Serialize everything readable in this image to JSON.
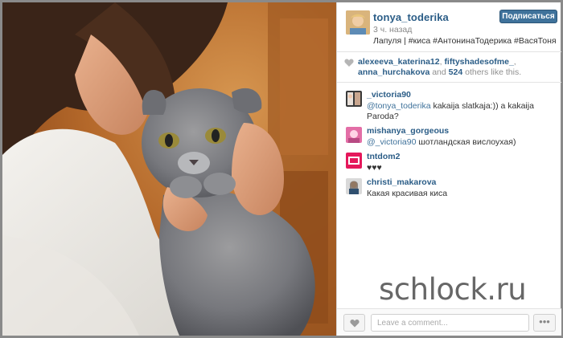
{
  "post": {
    "username": "tonya_toderika",
    "time": "3 ч. назад",
    "caption": "Лапуля | #киса #АнтонинаТодерика #ВасяТоня",
    "follow_label": "Подписаться"
  },
  "likes": {
    "user1": "alexeeva_katerina12",
    "sep1": ", ",
    "user2": "fiftyshadesofme_",
    "sep2": ",",
    "user3": "anna_hurchakova",
    "and_text": " and ",
    "count": "524",
    "others_text": " others like this."
  },
  "comments": [
    {
      "user": "_victoria90",
      "mention": "@tonya_toderika",
      "text": " kakaija slatkaja:)) a kakaija Paroda?"
    },
    {
      "user": "mishanya_gorgeous",
      "mention": "@_victoria90",
      "text": " шотландская вислоухая)"
    },
    {
      "user": "tntdom2",
      "mention": "",
      "text": "♥♥♥"
    },
    {
      "user": "christi_makarova",
      "mention": "",
      "text": "Какая красивая киса"
    }
  ],
  "footer": {
    "comment_placeholder": "Leave a comment...",
    "more_label": "•••"
  },
  "watermark": "schlock.ru",
  "icons": {
    "like": "heart-icon",
    "more": "more-dots-icon",
    "likes_heart": "heart-icon"
  },
  "colors": {
    "accent": "#3f729b",
    "username": "#2b5d87",
    "muted": "#8f8f8f"
  }
}
